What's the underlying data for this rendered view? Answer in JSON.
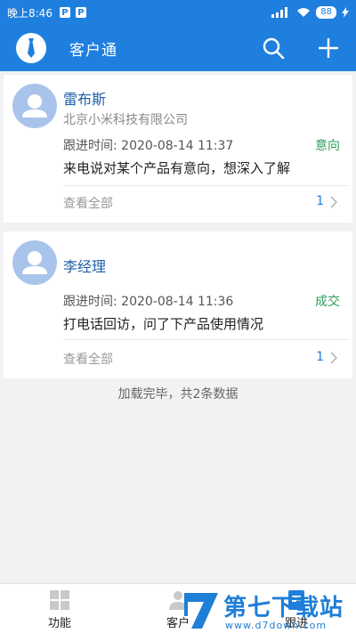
{
  "status_bar": {
    "time": "晚上8:46",
    "p1": "P",
    "p2": "P",
    "battery": "88"
  },
  "app_bar": {
    "title": "客户通",
    "logo_icon": "tie-icon",
    "search_icon": "search-icon",
    "add_icon": "plus-icon",
    "accent": "#1f7fde"
  },
  "customers": [
    {
      "name": "雷布斯",
      "company": "北京小米科技有限公司",
      "follow_time": "跟进时间: 2020-08-14 11:37",
      "status": "意向",
      "note": "来电说对某个产品有意向，想深入了解",
      "view_all": "查看全部",
      "count": "1"
    },
    {
      "name": "李经理",
      "company": "",
      "follow_time": "跟进时间: 2020-08-14 11:36",
      "status": "成交",
      "note": "打电话回访，问了下产品使用情况",
      "view_all": "查看全部",
      "count": "1"
    }
  ],
  "list_footer": "加载完毕，共2条数据",
  "tab_bar": {
    "tabs": [
      {
        "label": "功能",
        "icon": "grid-icon"
      },
      {
        "label": "客户",
        "icon": "person-icon"
      },
      {
        "label": "跟进",
        "icon": "note-icon"
      }
    ]
  },
  "watermark": {
    "title": "第七下载站",
    "url": "www.d7down.com"
  },
  "colors": {
    "status_green": "#2e9e5b",
    "name_blue": "#1f5fa8"
  }
}
